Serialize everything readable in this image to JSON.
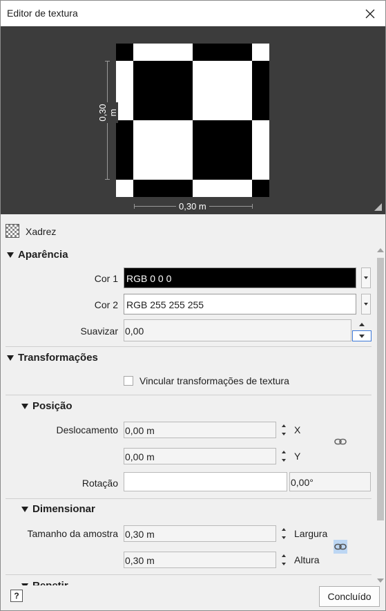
{
  "window": {
    "title": "Editor de textura"
  },
  "preview": {
    "height_label": "0,30 m",
    "width_label": "0,30 m"
  },
  "texture": {
    "name": "Xadrez",
    "icon": "checker-pattern-icon"
  },
  "appearance": {
    "heading": "Aparência",
    "color1": {
      "label": "Cor 1",
      "value": "RGB 0 0 0",
      "swatch": "#000000"
    },
    "color2": {
      "label": "Cor 2",
      "value": "RGB 255 255 255",
      "swatch": "#ffffff"
    },
    "smooth": {
      "label": "Suavizar",
      "value": "0,00"
    }
  },
  "transforms": {
    "heading": "Transformações",
    "link_label": "Vincular transformações de textura",
    "position": {
      "heading": "Posição",
      "offset_label": "Deslocamento",
      "offset_x": "0,00 m",
      "offset_y": "0,00 m",
      "x_axis": "X",
      "y_axis": "Y",
      "rotation_label": "Rotação",
      "rotation_value": "0,00°"
    },
    "scale": {
      "heading": "Dimensionar",
      "sample_label": "Tamanho da amostra",
      "width_value": "0,30 m",
      "height_value": "0,30 m",
      "width_axis": "Largura",
      "height_axis": "Altura"
    },
    "repeat": {
      "heading": "Repetir"
    }
  },
  "footer": {
    "help": "?",
    "done_label": "Concluído"
  }
}
